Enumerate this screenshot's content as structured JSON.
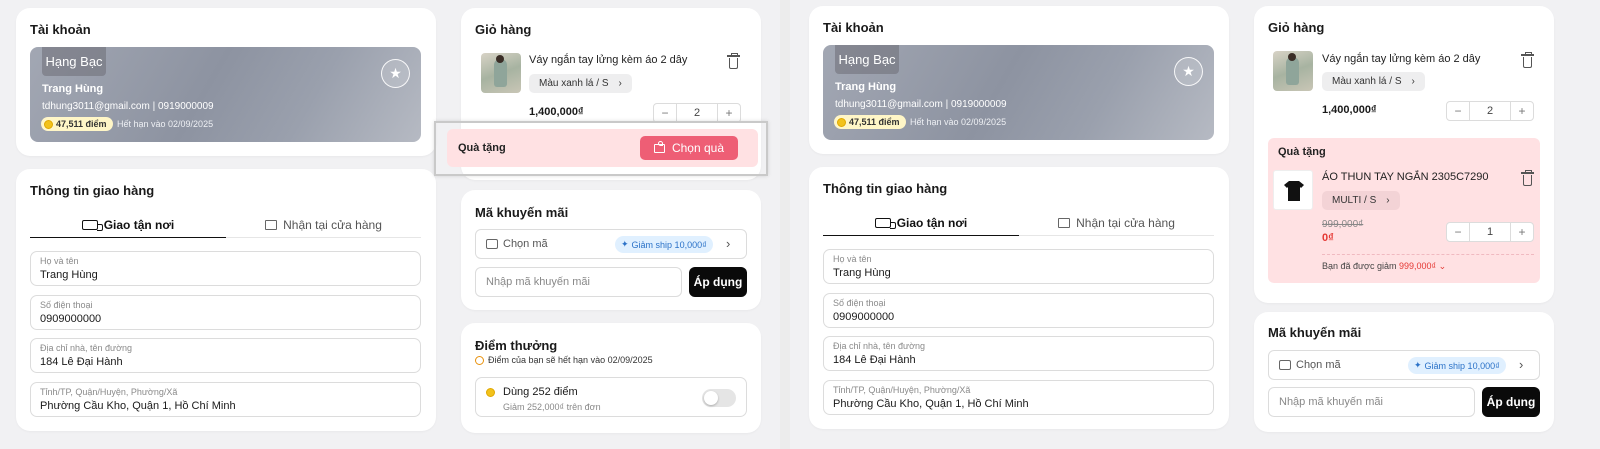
{
  "account": {
    "title": "Tài khoản",
    "tier": "Hạng Bạc",
    "name": "Trang Hùng",
    "contact": "tdhung3011@gmail.com | 0919000009",
    "points": "47,511 điểm",
    "expire": "Hết hạn vào 02/09/2025"
  },
  "shipping": {
    "title": "Thông tin giao hàng",
    "tab_delivery": "Giao tận nơi",
    "tab_pickup": "Nhận tại cửa hàng",
    "fields": [
      {
        "label": "Họ và tên",
        "value": "Trang Hùng"
      },
      {
        "label": "Số điện thoại",
        "value": "0909000000"
      },
      {
        "label": "Địa chỉ nhà, tên đường",
        "value": "184 Lê Đại Hành"
      },
      {
        "label": "Tỉnh/TP, Quận/Huyện, Phường/Xã",
        "value": "Phường Cầu Kho, Quận 1, Hồ Chí Minh"
      }
    ]
  },
  "cart": {
    "title": "Giỏ hàng",
    "product_name": "Váy ngắn tay lửng kèm áo 2 dây",
    "variant": "Màu xanh lá / S",
    "price": "1,400,000₫",
    "qty": "2"
  },
  "gift": {
    "title": "Quà tặng",
    "choose_label": "Chọn quà",
    "product_name": "ÁO THUN TAY NGẮN 2305C7290",
    "variant": "MULTI / S",
    "old_price": "999,000₫",
    "new_price": "0₫",
    "qty": "1",
    "discount_text": "Bạn đã được giảm",
    "discount_value": "999,000₫"
  },
  "promo": {
    "title": "Mã khuyến mãi",
    "select_label": "Chọn mã",
    "chip": "Giảm ship 10,000₫",
    "placeholder": "Nhập mã khuyến mãi",
    "apply": "Áp dụng"
  },
  "rewards": {
    "title": "Điểm thưởng",
    "note": "Điểm của bạn sẽ hết hạn vào 02/09/2025",
    "use_label": "Dùng 252 điểm",
    "use_sub": "Giảm 252,000₫ trên đơn"
  },
  "icons": {
    "star": "star-icon",
    "trash": "trash-icon",
    "gift": "gift-icon",
    "truck": "truck-icon",
    "store": "store-icon",
    "ticket": "ticket-icon",
    "chevron": "chevron-right-icon",
    "sparkle": "sparkle-icon",
    "clock": "clock-icon",
    "coin": "coin-icon"
  },
  "colors": {
    "accent_pink": "#ee5e75",
    "gift_bg": "#ffe1e3",
    "chip_blue": "#2b72c8",
    "new_price": "#e53935"
  }
}
